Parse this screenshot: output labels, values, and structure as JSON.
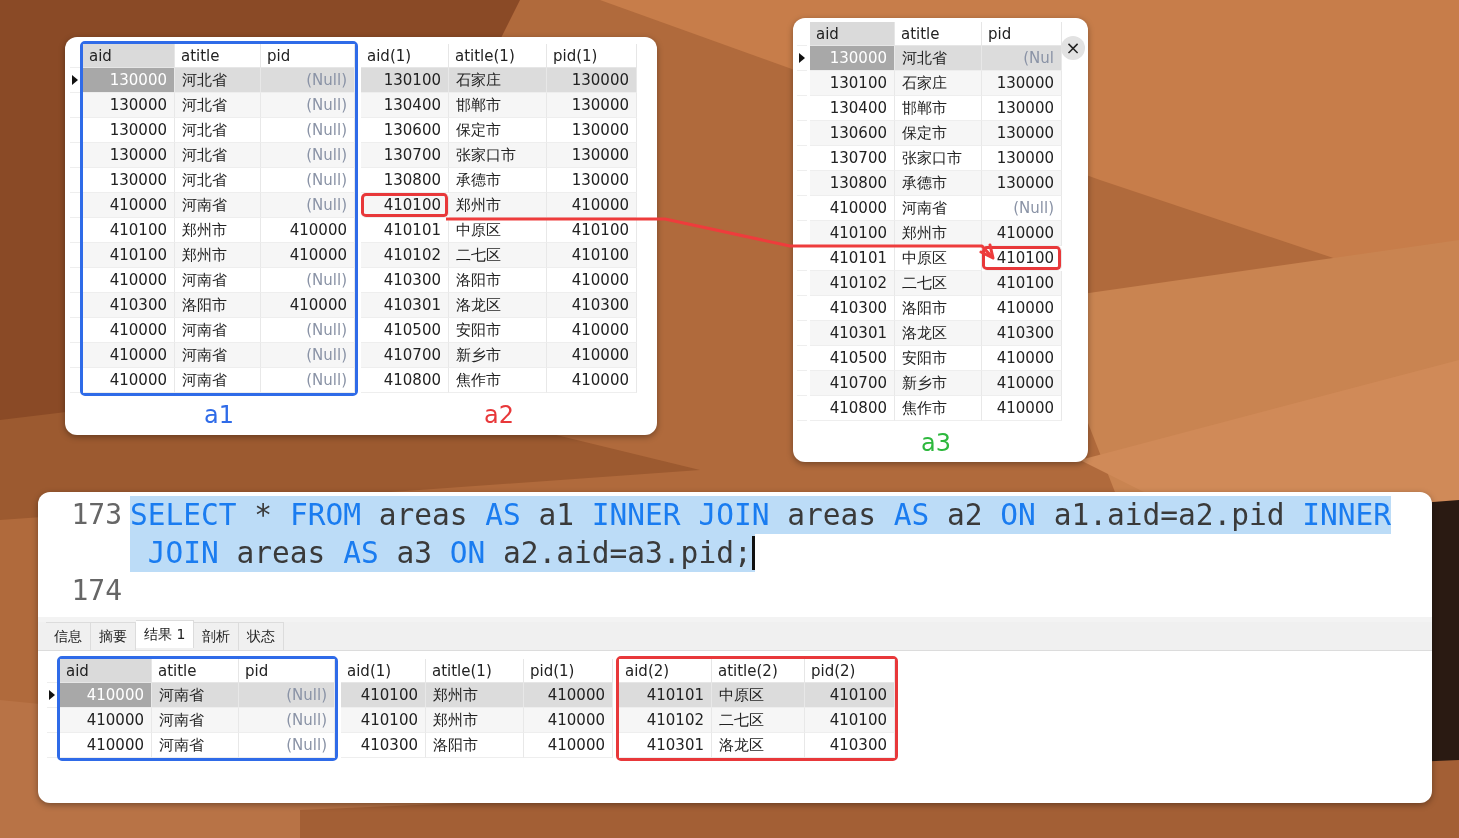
{
  "windows": [
    {
      "grid": {
        "columns": [
          {
            "title": "aid",
            "kind": "number",
            "selected": true
          },
          {
            "title": "atitle",
            "kind": "text",
            "selected": false
          },
          {
            "title": "pid",
            "kind": "number",
            "selected": false
          },
          {
            "title": "aid(1)",
            "kind": "number",
            "selected": false
          },
          {
            "title": "atitle(1)",
            "kind": "text",
            "selected": false
          },
          {
            "title": "pid(1)",
            "kind": "number",
            "selected": false
          }
        ],
        "groups": [
          {
            "label": "a1",
            "color": "#2f6be8",
            "outlined": true
          },
          {
            "label": "a2",
            "color": "#e8383a",
            "outlined": false
          }
        ],
        "rows": [
          {
            "selected": true,
            "cells": [
              "130000",
              "河北省",
              {
                "text": "(Null)",
                "null": true
              },
              "130100",
              "石家庄",
              "130000"
            ]
          },
          {
            "selected": false,
            "cells": [
              "130000",
              "河北省",
              {
                "text": "(Null)",
                "null": true
              },
              "130400",
              "邯郸市",
              "130000"
            ]
          },
          {
            "selected": false,
            "cells": [
              "130000",
              "河北省",
              {
                "text": "(Null)",
                "null": true
              },
              "130600",
              "保定市",
              "130000"
            ]
          },
          {
            "selected": false,
            "cells": [
              "130000",
              "河北省",
              {
                "text": "(Null)",
                "null": true
              },
              "130700",
              "张家口市",
              "130000"
            ]
          },
          {
            "selected": false,
            "cells": [
              "130000",
              "河北省",
              {
                "text": "(Null)",
                "null": true
              },
              "130800",
              "承德市",
              "130000"
            ]
          },
          {
            "selected": false,
            "cells": [
              "410000",
              "河南省",
              {
                "text": "(Null)",
                "null": true
              },
              {
                "text": "410100",
                "highlighted": true
              },
              "郑州市",
              "410000"
            ]
          },
          {
            "selected": false,
            "cells": [
              "410100",
              "郑州市",
              "410000",
              "410101",
              "中原区",
              "410100"
            ]
          },
          {
            "selected": false,
            "cells": [
              "410100",
              "郑州市",
              "410000",
              "410102",
              "二七区",
              "410100"
            ]
          },
          {
            "selected": false,
            "cells": [
              "410000",
              "河南省",
              {
                "text": "(Null)",
                "null": true
              },
              "410300",
              "洛阳市",
              "410000"
            ]
          },
          {
            "selected": false,
            "cells": [
              "410300",
              "洛阳市",
              "410000",
              "410301",
              "洛龙区",
              "410300"
            ]
          },
          {
            "selected": false,
            "cells": [
              "410000",
              "河南省",
              {
                "text": "(Null)",
                "null": true
              },
              "410500",
              "安阳市",
              "410000"
            ]
          },
          {
            "selected": false,
            "cells": [
              "410000",
              "河南省",
              {
                "text": "(Null)",
                "null": true
              },
              "410700",
              "新乡市",
              "410000"
            ]
          },
          {
            "selected": false,
            "cells": [
              "410000",
              "河南省",
              {
                "text": "(Null)",
                "null": true
              },
              "410800",
              "焦作市",
              "410000"
            ]
          }
        ]
      }
    },
    {
      "close": "×",
      "grid": {
        "columns": [
          {
            "title": "aid",
            "kind": "number",
            "selected": true
          },
          {
            "title": "atitle",
            "kind": "text",
            "selected": false
          },
          {
            "title": "pid",
            "kind": "number",
            "selected": false
          }
        ],
        "groups": [
          {
            "label": "a3",
            "color": "#2db83d",
            "outlined": false
          }
        ],
        "rows": [
          {
            "selected": true,
            "cells": [
              "130000",
              "河北省",
              {
                "text": "(Nul",
                "null": true
              }
            ]
          },
          {
            "selected": false,
            "cells": [
              "130100",
              "石家庄",
              "130000"
            ]
          },
          {
            "selected": false,
            "cells": [
              "130400",
              "邯郸市",
              "130000"
            ]
          },
          {
            "selected": false,
            "cells": [
              "130600",
              "保定市",
              "130000"
            ]
          },
          {
            "selected": false,
            "cells": [
              "130700",
              "张家口市",
              "130000"
            ]
          },
          {
            "selected": false,
            "cells": [
              "130800",
              "承德市",
              "130000"
            ]
          },
          {
            "selected": false,
            "cells": [
              "410000",
              "河南省",
              {
                "text": "(Null)",
                "null": true
              }
            ]
          },
          {
            "selected": false,
            "cells": [
              "410100",
              "郑州市",
              "410000"
            ]
          },
          {
            "selected": false,
            "cells": [
              "410101",
              "中原区",
              {
                "text": "410100",
                "highlighted": true
              }
            ]
          },
          {
            "selected": false,
            "cells": [
              "410102",
              "二七区",
              "410100"
            ]
          },
          {
            "selected": false,
            "cells": [
              "410300",
              "洛阳市",
              "410000"
            ]
          },
          {
            "selected": false,
            "cells": [
              "410301",
              "洛龙区",
              "410300"
            ]
          },
          {
            "selected": false,
            "cells": [
              "410500",
              "安阳市",
              "410000"
            ]
          },
          {
            "selected": false,
            "cells": [
              "410700",
              "新乡市",
              "410000"
            ]
          },
          {
            "selected": false,
            "cells": [
              "410800",
              "焦作市",
              "410000"
            ]
          }
        ]
      }
    }
  ],
  "editor": {
    "lines": [
      {
        "number": "173",
        "selected": true,
        "cursor": true,
        "rows": [
          [
            {
              "text": "SELECT",
              "kind": "keyword"
            },
            {
              "text": " * ",
              "kind": "plain"
            },
            {
              "text": "FROM",
              "kind": "keyword"
            },
            {
              "text": " areas ",
              "kind": "plain"
            },
            {
              "text": "AS",
              "kind": "keyword"
            },
            {
              "text": " a1 ",
              "kind": "plain"
            },
            {
              "text": "INNER JOIN",
              "kind": "keyword"
            },
            {
              "text": " areas ",
              "kind": "plain"
            },
            {
              "text": "AS",
              "kind": "keyword"
            },
            {
              "text": " a2 ",
              "kind": "plain"
            },
            {
              "text": "ON",
              "kind": "keyword"
            },
            {
              "text": " a1.aid=a2.pid ",
              "kind": "plain"
            },
            {
              "text": "INNER",
              "kind": "keyword"
            }
          ],
          [
            {
              "text": " JOIN",
              "kind": "keyword"
            },
            {
              "text": " areas ",
              "kind": "plain"
            },
            {
              "text": "AS",
              "kind": "keyword"
            },
            {
              "text": " a3 ",
              "kind": "plain"
            },
            {
              "text": "ON",
              "kind": "keyword"
            },
            {
              "text": " a2.aid=a3.pid;",
              "kind": "plain"
            }
          ]
        ]
      },
      {
        "number": "174"
      }
    ]
  },
  "tabs": [
    {
      "label": "信息",
      "selected": false
    },
    {
      "label": "摘要",
      "selected": false
    },
    {
      "label": "结果 1",
      "selected": true
    },
    {
      "label": "剖析",
      "selected": false
    },
    {
      "label": "状态",
      "selected": false
    }
  ],
  "result": {
    "columns": [
      {
        "title": "aid",
        "kind": "number",
        "selected": true
      },
      {
        "title": "atitle",
        "kind": "text",
        "selected": false
      },
      {
        "title": "pid",
        "kind": "number",
        "selected": false
      },
      {
        "title": "aid(1)",
        "kind": "number",
        "selected": false
      },
      {
        "title": "atitle(1)",
        "kind": "text",
        "selected": false
      },
      {
        "title": "pid(1)",
        "kind": "number",
        "selected": false
      },
      {
        "title": "aid(2)",
        "kind": "number",
        "selected": false
      },
      {
        "title": "atitle(2)",
        "kind": "text",
        "selected": false
      },
      {
        "title": "pid(2)",
        "kind": "number",
        "selected": false
      }
    ],
    "groups": [
      {
        "color": "#2f6be8",
        "outlined": true
      },
      {
        "outlined": false
      },
      {
        "color": "#e8383a",
        "outlined": true
      }
    ],
    "rows": [
      {
        "selected": true,
        "cells": [
          "410000",
          "河南省",
          {
            "text": "(Null)",
            "null": true
          },
          "410100",
          "郑州市",
          "410000",
          "410101",
          "中原区",
          "410100"
        ]
      },
      {
        "selected": false,
        "cells": [
          "410000",
          "河南省",
          {
            "text": "(Null)",
            "null": true
          },
          "410100",
          "郑州市",
          "410000",
          "410102",
          "二七区",
          "410100"
        ]
      },
      {
        "selected": false,
        "cells": [
          "410000",
          "河南省",
          {
            "text": "(Null)",
            "null": true
          },
          "410300",
          "洛阳市",
          "410000",
          "410301",
          "洛龙区",
          "410300"
        ]
      }
    ]
  }
}
